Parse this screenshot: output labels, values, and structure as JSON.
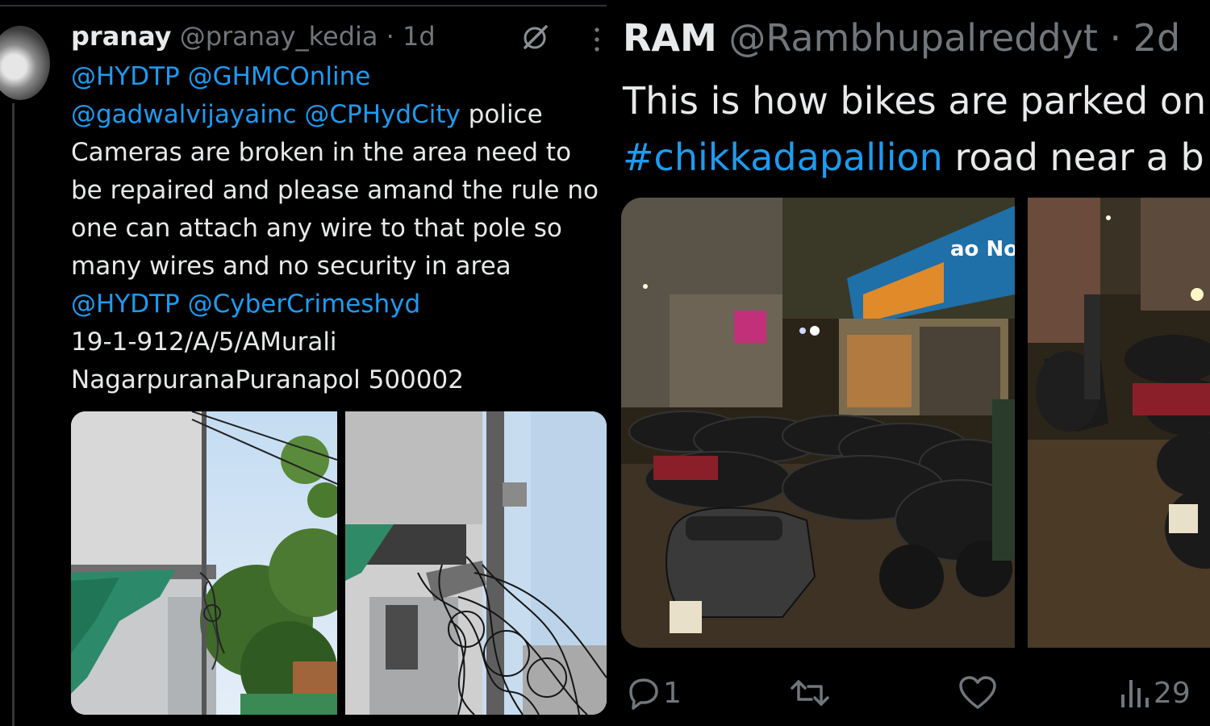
{
  "left_tweet": {
    "display_name": "pranay",
    "handle": "@pranay_kedia",
    "separator": "·",
    "time": "1d",
    "body_lines": [
      [
        {
          "text": "@HYDTP @GHMCOnline",
          "link": true
        }
      ],
      [
        {
          "text": "@gadwalvijayainc @CPHydCity",
          "link": true
        },
        {
          "text": " police",
          "link": false
        }
      ],
      [
        {
          "text": "Cameras are broken in the area need to",
          "link": false
        }
      ],
      [
        {
          "text": "be repaired and please amand the rule no",
          "link": false
        }
      ],
      [
        {
          "text": "one can attach any wire to that pole so",
          "link": false
        }
      ],
      [
        {
          "text": "many wires and no security in area",
          "link": false
        }
      ],
      [
        {
          "text": "@HYDTP @CyberCrimeshyd",
          "link": true
        }
      ],
      [
        {
          "text": "19-1-912/A/5/AMurali",
          "link": false
        }
      ],
      [
        {
          "text": "NagarpuranaPuranapol 500002",
          "link": false
        }
      ]
    ],
    "icons": {
      "grok": "grok-slash-icon",
      "more": "more-vertical-icon"
    }
  },
  "right_tweet": {
    "display_name": "RAM",
    "handle": "@Rambhupalreddyt",
    "separator": "·",
    "time": "2d",
    "body_lines": [
      [
        {
          "text": "This is how bikes are parked on",
          "link": false
        }
      ],
      [
        {
          "text": "#chikkadapallion",
          "link": true
        },
        {
          "text": " road near a b",
          "link": false
        }
      ]
    ],
    "shop_sign": "ao No",
    "actions": {
      "reply_count": "1",
      "retweet_count": "",
      "like_count": "",
      "views_count": "29"
    }
  },
  "colors": {
    "background": "#000000",
    "text": "#e7e9ea",
    "muted": "#71767b",
    "link": "#1d9bf0"
  }
}
